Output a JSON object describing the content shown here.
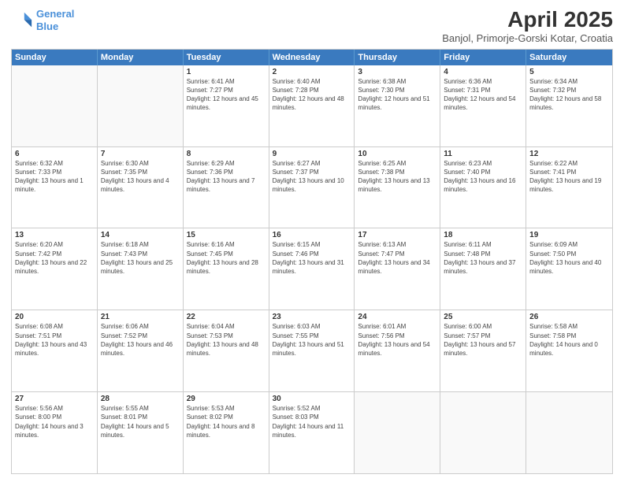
{
  "header": {
    "logo_line1": "General",
    "logo_line2": "Blue",
    "title": "April 2025",
    "subtitle": "Banjol, Primorje-Gorski Kotar, Croatia"
  },
  "calendar": {
    "days_of_week": [
      "Sunday",
      "Monday",
      "Tuesday",
      "Wednesday",
      "Thursday",
      "Friday",
      "Saturday"
    ],
    "weeks": [
      [
        {
          "day": "",
          "empty": true
        },
        {
          "day": "",
          "empty": true
        },
        {
          "day": "1",
          "sunrise": "6:41 AM",
          "sunset": "7:27 PM",
          "daylight": "12 hours and 45 minutes."
        },
        {
          "day": "2",
          "sunrise": "6:40 AM",
          "sunset": "7:28 PM",
          "daylight": "12 hours and 48 minutes."
        },
        {
          "day": "3",
          "sunrise": "6:38 AM",
          "sunset": "7:30 PM",
          "daylight": "12 hours and 51 minutes."
        },
        {
          "day": "4",
          "sunrise": "6:36 AM",
          "sunset": "7:31 PM",
          "daylight": "12 hours and 54 minutes."
        },
        {
          "day": "5",
          "sunrise": "6:34 AM",
          "sunset": "7:32 PM",
          "daylight": "12 hours and 58 minutes."
        }
      ],
      [
        {
          "day": "6",
          "sunrise": "6:32 AM",
          "sunset": "7:33 PM",
          "daylight": "13 hours and 1 minute."
        },
        {
          "day": "7",
          "sunrise": "6:30 AM",
          "sunset": "7:35 PM",
          "daylight": "13 hours and 4 minutes."
        },
        {
          "day": "8",
          "sunrise": "6:29 AM",
          "sunset": "7:36 PM",
          "daylight": "13 hours and 7 minutes."
        },
        {
          "day": "9",
          "sunrise": "6:27 AM",
          "sunset": "7:37 PM",
          "daylight": "13 hours and 10 minutes."
        },
        {
          "day": "10",
          "sunrise": "6:25 AM",
          "sunset": "7:38 PM",
          "daylight": "13 hours and 13 minutes."
        },
        {
          "day": "11",
          "sunrise": "6:23 AM",
          "sunset": "7:40 PM",
          "daylight": "13 hours and 16 minutes."
        },
        {
          "day": "12",
          "sunrise": "6:22 AM",
          "sunset": "7:41 PM",
          "daylight": "13 hours and 19 minutes."
        }
      ],
      [
        {
          "day": "13",
          "sunrise": "6:20 AM",
          "sunset": "7:42 PM",
          "daylight": "13 hours and 22 minutes."
        },
        {
          "day": "14",
          "sunrise": "6:18 AM",
          "sunset": "7:43 PM",
          "daylight": "13 hours and 25 minutes."
        },
        {
          "day": "15",
          "sunrise": "6:16 AM",
          "sunset": "7:45 PM",
          "daylight": "13 hours and 28 minutes."
        },
        {
          "day": "16",
          "sunrise": "6:15 AM",
          "sunset": "7:46 PM",
          "daylight": "13 hours and 31 minutes."
        },
        {
          "day": "17",
          "sunrise": "6:13 AM",
          "sunset": "7:47 PM",
          "daylight": "13 hours and 34 minutes."
        },
        {
          "day": "18",
          "sunrise": "6:11 AM",
          "sunset": "7:48 PM",
          "daylight": "13 hours and 37 minutes."
        },
        {
          "day": "19",
          "sunrise": "6:09 AM",
          "sunset": "7:50 PM",
          "daylight": "13 hours and 40 minutes."
        }
      ],
      [
        {
          "day": "20",
          "sunrise": "6:08 AM",
          "sunset": "7:51 PM",
          "daylight": "13 hours and 43 minutes."
        },
        {
          "day": "21",
          "sunrise": "6:06 AM",
          "sunset": "7:52 PM",
          "daylight": "13 hours and 46 minutes."
        },
        {
          "day": "22",
          "sunrise": "6:04 AM",
          "sunset": "7:53 PM",
          "daylight": "13 hours and 48 minutes."
        },
        {
          "day": "23",
          "sunrise": "6:03 AM",
          "sunset": "7:55 PM",
          "daylight": "13 hours and 51 minutes."
        },
        {
          "day": "24",
          "sunrise": "6:01 AM",
          "sunset": "7:56 PM",
          "daylight": "13 hours and 54 minutes."
        },
        {
          "day": "25",
          "sunrise": "6:00 AM",
          "sunset": "7:57 PM",
          "daylight": "13 hours and 57 minutes."
        },
        {
          "day": "26",
          "sunrise": "5:58 AM",
          "sunset": "7:58 PM",
          "daylight": "14 hours and 0 minutes."
        }
      ],
      [
        {
          "day": "27",
          "sunrise": "5:56 AM",
          "sunset": "8:00 PM",
          "daylight": "14 hours and 3 minutes."
        },
        {
          "day": "28",
          "sunrise": "5:55 AM",
          "sunset": "8:01 PM",
          "daylight": "14 hours and 5 minutes."
        },
        {
          "day": "29",
          "sunrise": "5:53 AM",
          "sunset": "8:02 PM",
          "daylight": "14 hours and 8 minutes."
        },
        {
          "day": "30",
          "sunrise": "5:52 AM",
          "sunset": "8:03 PM",
          "daylight": "14 hours and 11 minutes."
        },
        {
          "day": "",
          "empty": true
        },
        {
          "day": "",
          "empty": true
        },
        {
          "day": "",
          "empty": true
        }
      ]
    ]
  }
}
